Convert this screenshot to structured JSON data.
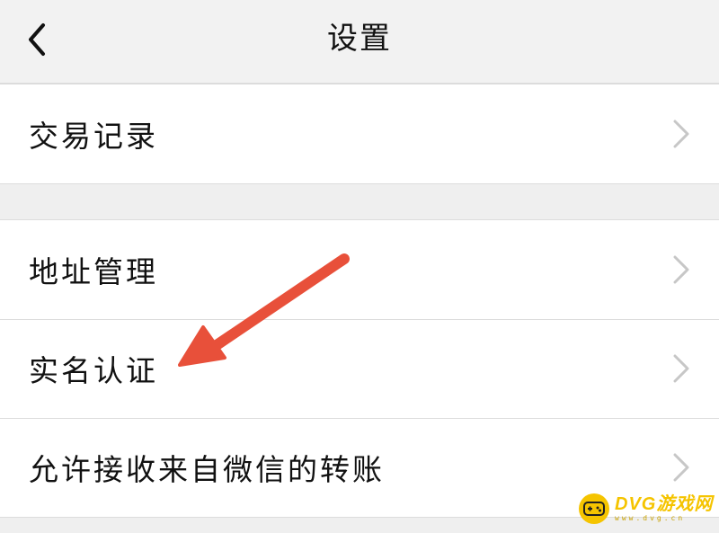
{
  "header": {
    "title": "设置",
    "back_icon": "chevron-left-icon"
  },
  "groups": [
    {
      "items": [
        {
          "label": "交易记录"
        }
      ]
    },
    {
      "items": [
        {
          "label": "地址管理"
        },
        {
          "label": "实名认证"
        },
        {
          "label": "允许接收来自微信的转账"
        }
      ]
    }
  ],
  "annotation": {
    "type": "arrow",
    "color": "#e8503a",
    "points_to": "实名认证"
  },
  "watermark": {
    "name": "DVG游戏网",
    "subtitle": "www.dvg.cn",
    "color": "#f5c400"
  },
  "colors": {
    "background": "#efefef",
    "row_background": "#ffffff",
    "divider": "#dcdcdc",
    "chevron": "#c7c7c7"
  }
}
